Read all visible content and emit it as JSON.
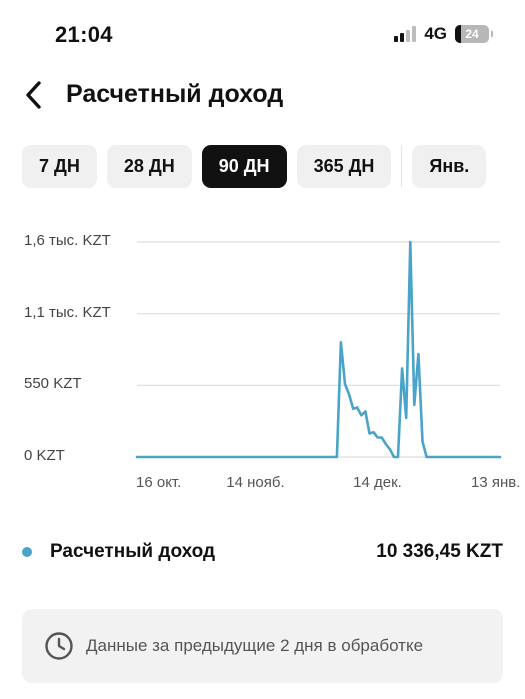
{
  "status_bar": {
    "time": "21:04",
    "network": "4G",
    "battery": "24",
    "signal_bars_active": 2
  },
  "header": {
    "back_icon": "chevron-left-icon",
    "title": "Расчетный доход"
  },
  "tabs": [
    {
      "label": "7 ДН",
      "active": false
    },
    {
      "label": "28 ДН",
      "active": false
    },
    {
      "label": "90 ДН",
      "active": true
    },
    {
      "label": "365 ДН",
      "active": false
    },
    {
      "label": "Янв.",
      "active": false
    }
  ],
  "chart_data": {
    "type": "line",
    "y_tick_labels": [
      "1,6 тыс. KZT",
      "1,1 тыс. KZT",
      "550 KZT",
      "0 KZT"
    ],
    "y_ticks": [
      1650,
      1100,
      550,
      0
    ],
    "ylim": [
      0,
      1650
    ],
    "x_tick_labels": [
      "16 окт.",
      "14 нояб.",
      "14 дек.",
      "13 янв."
    ],
    "x_tick_index": [
      0,
      29,
      59,
      89
    ],
    "grid": true,
    "series": [
      {
        "color": "#4aa3c8",
        "values": [
          0,
          0,
          0,
          0,
          0,
          0,
          0,
          0,
          0,
          0,
          0,
          0,
          0,
          0,
          0,
          0,
          0,
          0,
          0,
          0,
          0,
          0,
          0,
          0,
          0,
          0,
          0,
          0,
          0,
          0,
          0,
          0,
          0,
          0,
          0,
          0,
          0,
          0,
          0,
          0,
          0,
          0,
          0,
          0,
          0,
          0,
          0,
          0,
          0,
          0,
          880,
          560,
          480,
          370,
          380,
          320,
          350,
          180,
          190,
          150,
          150,
          100,
          60,
          0,
          0,
          680,
          300,
          1650,
          400,
          790,
          120,
          0,
          0,
          0,
          0,
          0,
          0,
          0,
          0,
          0,
          0,
          0,
          0,
          0,
          0,
          0,
          0,
          0,
          0,
          0
        ]
      }
    ]
  },
  "summary": {
    "label": "Расчетный доход",
    "value": "10 336,45 KZT",
    "dot_color": "#4aa3c8"
  },
  "notice": {
    "icon": "clock-icon",
    "text": "Данные за предыдущие 2 дня в обработке"
  }
}
